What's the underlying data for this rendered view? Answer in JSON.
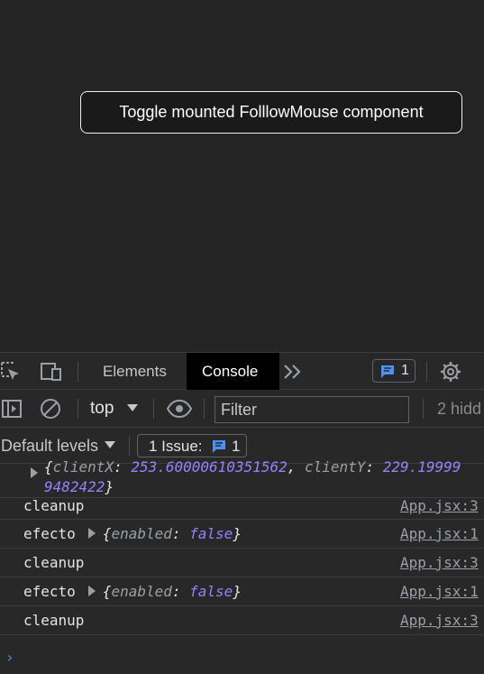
{
  "app": {
    "toggle_button_label": "Toggle mounted FolllowMouse component"
  },
  "devtools": {
    "tabs": [
      {
        "label": "Elements",
        "active": false
      },
      {
        "label": "Console",
        "active": true
      }
    ],
    "issues_badge_count": "1",
    "toolbar": {
      "context": "top",
      "filter_placeholder": "Filter",
      "hidden_count": "2 hidd"
    },
    "levels": {
      "label": "Default levels",
      "issues_label": "1 Issue:",
      "issues_count": "1"
    },
    "console": {
      "first_entry": {
        "line1_open": "{",
        "line1_key1": "clientX",
        "line1_sep": ": ",
        "line1_val1": "253.60000610351562",
        "line1_comma": ", ",
        "line1_key2": "clientY",
        "line1_val2": "229.19999",
        "line2_val": "9482422",
        "line2_close": "}"
      },
      "rows": [
        {
          "text": "cleanup",
          "source": "App.jsx:3"
        },
        {
          "text": "efecto",
          "object_key": "enabled",
          "object_value": "false",
          "source": "App.jsx:1"
        },
        {
          "text": "cleanup",
          "source": "App.jsx:3"
        },
        {
          "text": "efecto",
          "object_key": "enabled",
          "object_value": "false",
          "source": "App.jsx:1"
        },
        {
          "text": "cleanup",
          "source": "App.jsx:3"
        }
      ],
      "prompt_glyph": "›"
    }
  },
  "colors": {
    "page_bg": "#242424",
    "devtools_bg": "#282828",
    "accent_blue": "#4d90fe",
    "value_purple": "#9980ff"
  }
}
